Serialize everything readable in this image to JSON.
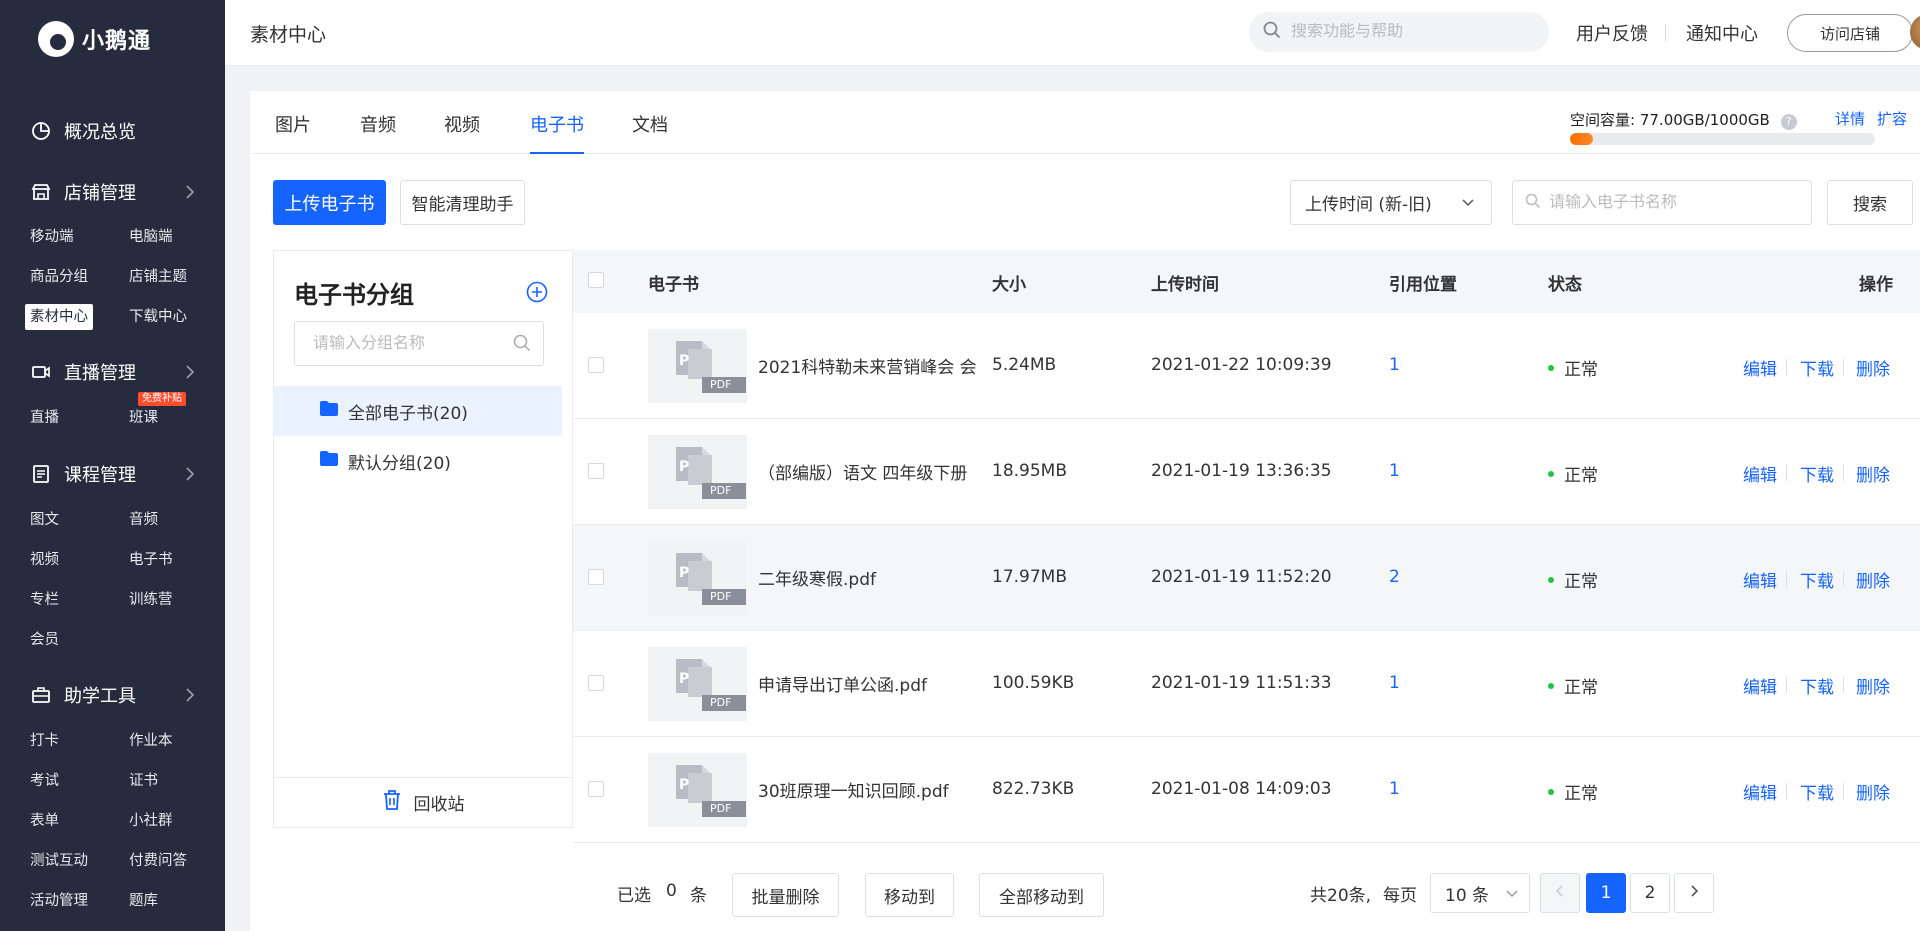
{
  "brand": {
    "name": "小鹅通"
  },
  "sidebar": {
    "sections": [
      {
        "label": "概况总览",
        "icon": "pie-chart-icon"
      },
      {
        "label": "店铺管理",
        "icon": "store-icon"
      },
      {
        "label": "直播管理",
        "icon": "video-camera-icon"
      },
      {
        "label": "课程管理",
        "icon": "course-list-icon"
      },
      {
        "label": "助学工具",
        "icon": "toolbox-icon"
      }
    ],
    "store_items": [
      "移动端",
      "电脑端",
      "商品分组",
      "店铺主题",
      "素材中心",
      "下载中心"
    ],
    "live_items": [
      "直播",
      "班课"
    ],
    "live_badge": "免费补贴",
    "course_items": [
      "图文",
      "音频",
      "视频",
      "电子书",
      "专栏",
      "训练营",
      "会员"
    ],
    "tool_items": [
      "打卡",
      "作业本",
      "考试",
      "证书",
      "表单",
      "小社群",
      "测试互动",
      "付费问答",
      "活动管理",
      "题库"
    ]
  },
  "header": {
    "title": "素材中心",
    "search_placeholder": "搜索功能与帮助",
    "feedback": "用户反馈",
    "notice": "通知中心",
    "visit_store": "访问店铺"
  },
  "tabs": [
    "图片",
    "音频",
    "视频",
    "电子书",
    "文档"
  ],
  "active_tab": 3,
  "capacity": {
    "label": "空间容量:",
    "value": "77.00GB/1000GB",
    "help": "?",
    "detail": "详情",
    "expand": "扩容",
    "used_fraction": 0.077
  },
  "toolbar": {
    "upload": "上传电子书",
    "clean": "智能清理助手",
    "sort": "上传时间 (新-旧)",
    "search_placeholder": "请输入电子书名称",
    "search_btn": "搜索"
  },
  "groups": {
    "title": "电子书分组",
    "search_placeholder": "请输入分组名称",
    "items": [
      "全部电子书(20)",
      "默认分组(20)"
    ],
    "recycle": "回收站"
  },
  "table": {
    "columns": [
      "电子书",
      "大小",
      "上传时间",
      "引用位置",
      "状态",
      "操作"
    ],
    "thumb_label": "PDF",
    "rows": [
      {
        "name": "2021科特勒未来营销峰会 会",
        "size": "5.24MB",
        "time": "2021-01-22 10:09:39",
        "refs": "1",
        "status": "正常"
      },
      {
        "name": "（部编版）语文 四年级下册",
        "size": "18.95MB",
        "time": "2021-01-19 13:36:35",
        "refs": "1",
        "status": "正常"
      },
      {
        "name": "二年级寒假.pdf",
        "size": "17.97MB",
        "time": "2021-01-19 11:52:20",
        "refs": "2",
        "status": "正常"
      },
      {
        "name": "申请导出订单公函.pdf",
        "size": "100.59KB",
        "time": "2021-01-19 11:51:33",
        "refs": "1",
        "status": "正常"
      },
      {
        "name": "30班原理一知识回顾.pdf",
        "size": "822.73KB",
        "time": "2021-01-08 14:09:03",
        "refs": "1",
        "status": "正常"
      }
    ],
    "ops": [
      "编辑",
      "下载",
      "删除"
    ]
  },
  "footer": {
    "selected_prefix": "已选",
    "selected_count": "0",
    "selected_suffix": "条",
    "batch_delete": "批量删除",
    "move_to": "移动到",
    "move_all": "全部移动到",
    "total": "共20条,",
    "per_page_label": "每页",
    "page_size": "10 条",
    "pages": [
      "1",
      "2"
    ]
  },
  "colors": {
    "sidebar": "#262c3d",
    "primary": "#1664ff",
    "capacity": "#ff6a00",
    "status_ok": "#23c343"
  }
}
